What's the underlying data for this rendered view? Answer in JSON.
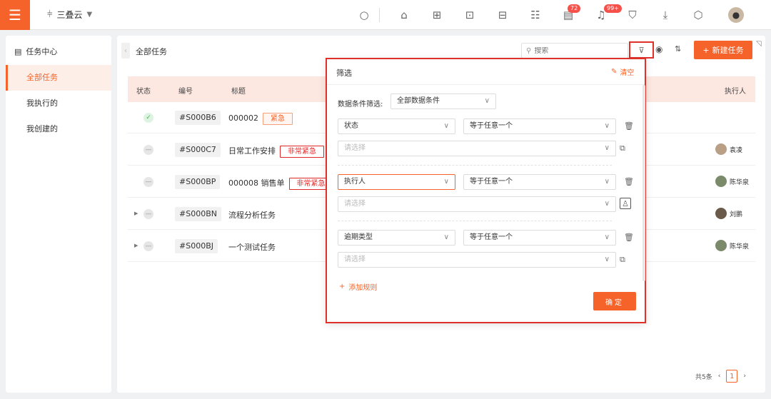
{
  "topbar": {
    "menu_icon": "hamburger-icon",
    "app_name": "三叠云",
    "notif_badge_1": "72",
    "notif_badge_2": "99+"
  },
  "sidebar": {
    "title": "任务中心",
    "items": [
      {
        "label": "全部任务",
        "active": true
      },
      {
        "label": "我执行的",
        "active": false
      },
      {
        "label": "我创建的",
        "active": false
      }
    ]
  },
  "main": {
    "title": "全部任务",
    "search_placeholder": "搜索",
    "new_task_label": "新建任务",
    "columns": {
      "status": "状态",
      "code": "编号",
      "title": "标题",
      "assignee": "执行人"
    },
    "rows": [
      {
        "status": "done",
        "code": "#S000B6",
        "title": "000002",
        "tag": "紧急",
        "tag_type": "urgent",
        "assignee": "",
        "expandable": false
      },
      {
        "status": "todo",
        "code": "#S000C7",
        "title": "日常工作安排",
        "tag": "非常紧急",
        "tag_type": "very",
        "assignee": "袁凌",
        "expandable": false
      },
      {
        "status": "todo",
        "code": "#S000BP",
        "title": "000008 销售单",
        "tag": "非常紧急",
        "tag_type": "very",
        "assignee": "陈华泉",
        "expandable": false
      },
      {
        "status": "todo",
        "code": "#S000BN",
        "title": "流程分析任务",
        "tag": "",
        "tag_type": "",
        "assignee": "刘鹏",
        "expandable": true
      },
      {
        "status": "todo",
        "code": "#S000BJ",
        "title": "一个测试任务",
        "tag": "",
        "tag_type": "",
        "assignee": "陈华泉",
        "expandable": true
      }
    ],
    "pager": {
      "total": "共5条",
      "current": "1"
    }
  },
  "filter": {
    "title": "筛选",
    "clear_label": "清空",
    "data_condition_label": "数据条件筛选:",
    "data_condition_value": "全部数据条件",
    "rules": [
      {
        "field": "状态",
        "op": "等于任意一个",
        "value_placeholder": "请选择"
      },
      {
        "field": "执行人",
        "op": "等于任意一个",
        "value_placeholder": "请选择"
      },
      {
        "field": "逾期类型",
        "op": "等于任意一个",
        "value_placeholder": "请选择"
      }
    ],
    "add_rule_label": "添加规则",
    "confirm_label": "确定"
  }
}
